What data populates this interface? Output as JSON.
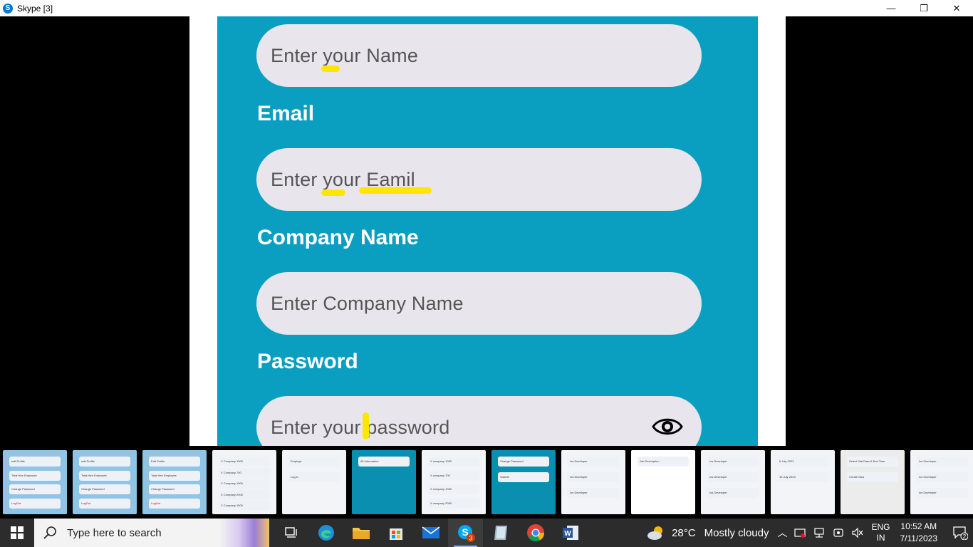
{
  "window": {
    "title": "Skype [3]",
    "controls": {
      "minimize": "—",
      "maximize": "❐",
      "close": "✕"
    }
  },
  "form": {
    "name_placeholder": "Enter your Name",
    "email_label": "Email",
    "email_placeholder": "Enter your Eamil",
    "company_label": "Company Name",
    "company_placeholder": "Enter Company Name",
    "password_label": "Password",
    "password_placeholder": "Enter your password",
    "password_toggle_icon": "eye-icon",
    "highlight_color": "#ffe600",
    "screen_color": "#0a9fc0"
  },
  "thumbnails": [
    {
      "rows": [
        "edit Profile",
        "Total Hire Employee",
        "Change Password",
        "LogOut"
      ]
    },
    {
      "rows": [
        "edit Profile",
        "Total Hire Employee",
        "Change Password",
        "LogOut"
      ]
    },
    {
      "rows": [
        "Edit Profile",
        "Total Hire Employee",
        "Change Password",
        "LogOut"
      ]
    },
    {
      "rows": [
        "X Company 1000",
        "X Company 700",
        "X Company 1000",
        "X Company 2000",
        "X Company 1500"
      ]
    },
    {
      "rows": [
        "Employe",
        "Log in"
      ]
    },
    {
      "rows": [
        "All Information"
      ]
    },
    {
      "rows": [
        "X company 1000",
        "X company 700",
        "X company 1000",
        "X company 2000"
      ]
    },
    {
      "rows": [
        "Change Password",
        "Submit"
      ]
    },
    {
      "rows": [
        "Ios Developer",
        "Ios Developer",
        "Ios Developer"
      ]
    },
    {
      "rows": [
        "Job Description"
      ]
    },
    {
      "rows": [
        "Ios Developer",
        "Ios Developer",
        "Ios Developer"
      ]
    },
    {
      "rows": [
        "6 July 2023",
        "15 July 2023"
      ]
    },
    {
      "rows": [
        "Select Dial Data & End Time",
        "Create Now"
      ]
    },
    {
      "rows": [
        "Ios Developer",
        "Ios Developer",
        "Ios Developer"
      ]
    }
  ],
  "taskbar": {
    "search_placeholder": "Type here to search",
    "skype_badge": "3",
    "weather_temp": "28°C",
    "weather_condition": "Mostly cloudy",
    "lang_line1": "ENG",
    "lang_line2": "IN",
    "time": "10:52 AM",
    "date": "7/11/2023",
    "notification_count": "2"
  }
}
